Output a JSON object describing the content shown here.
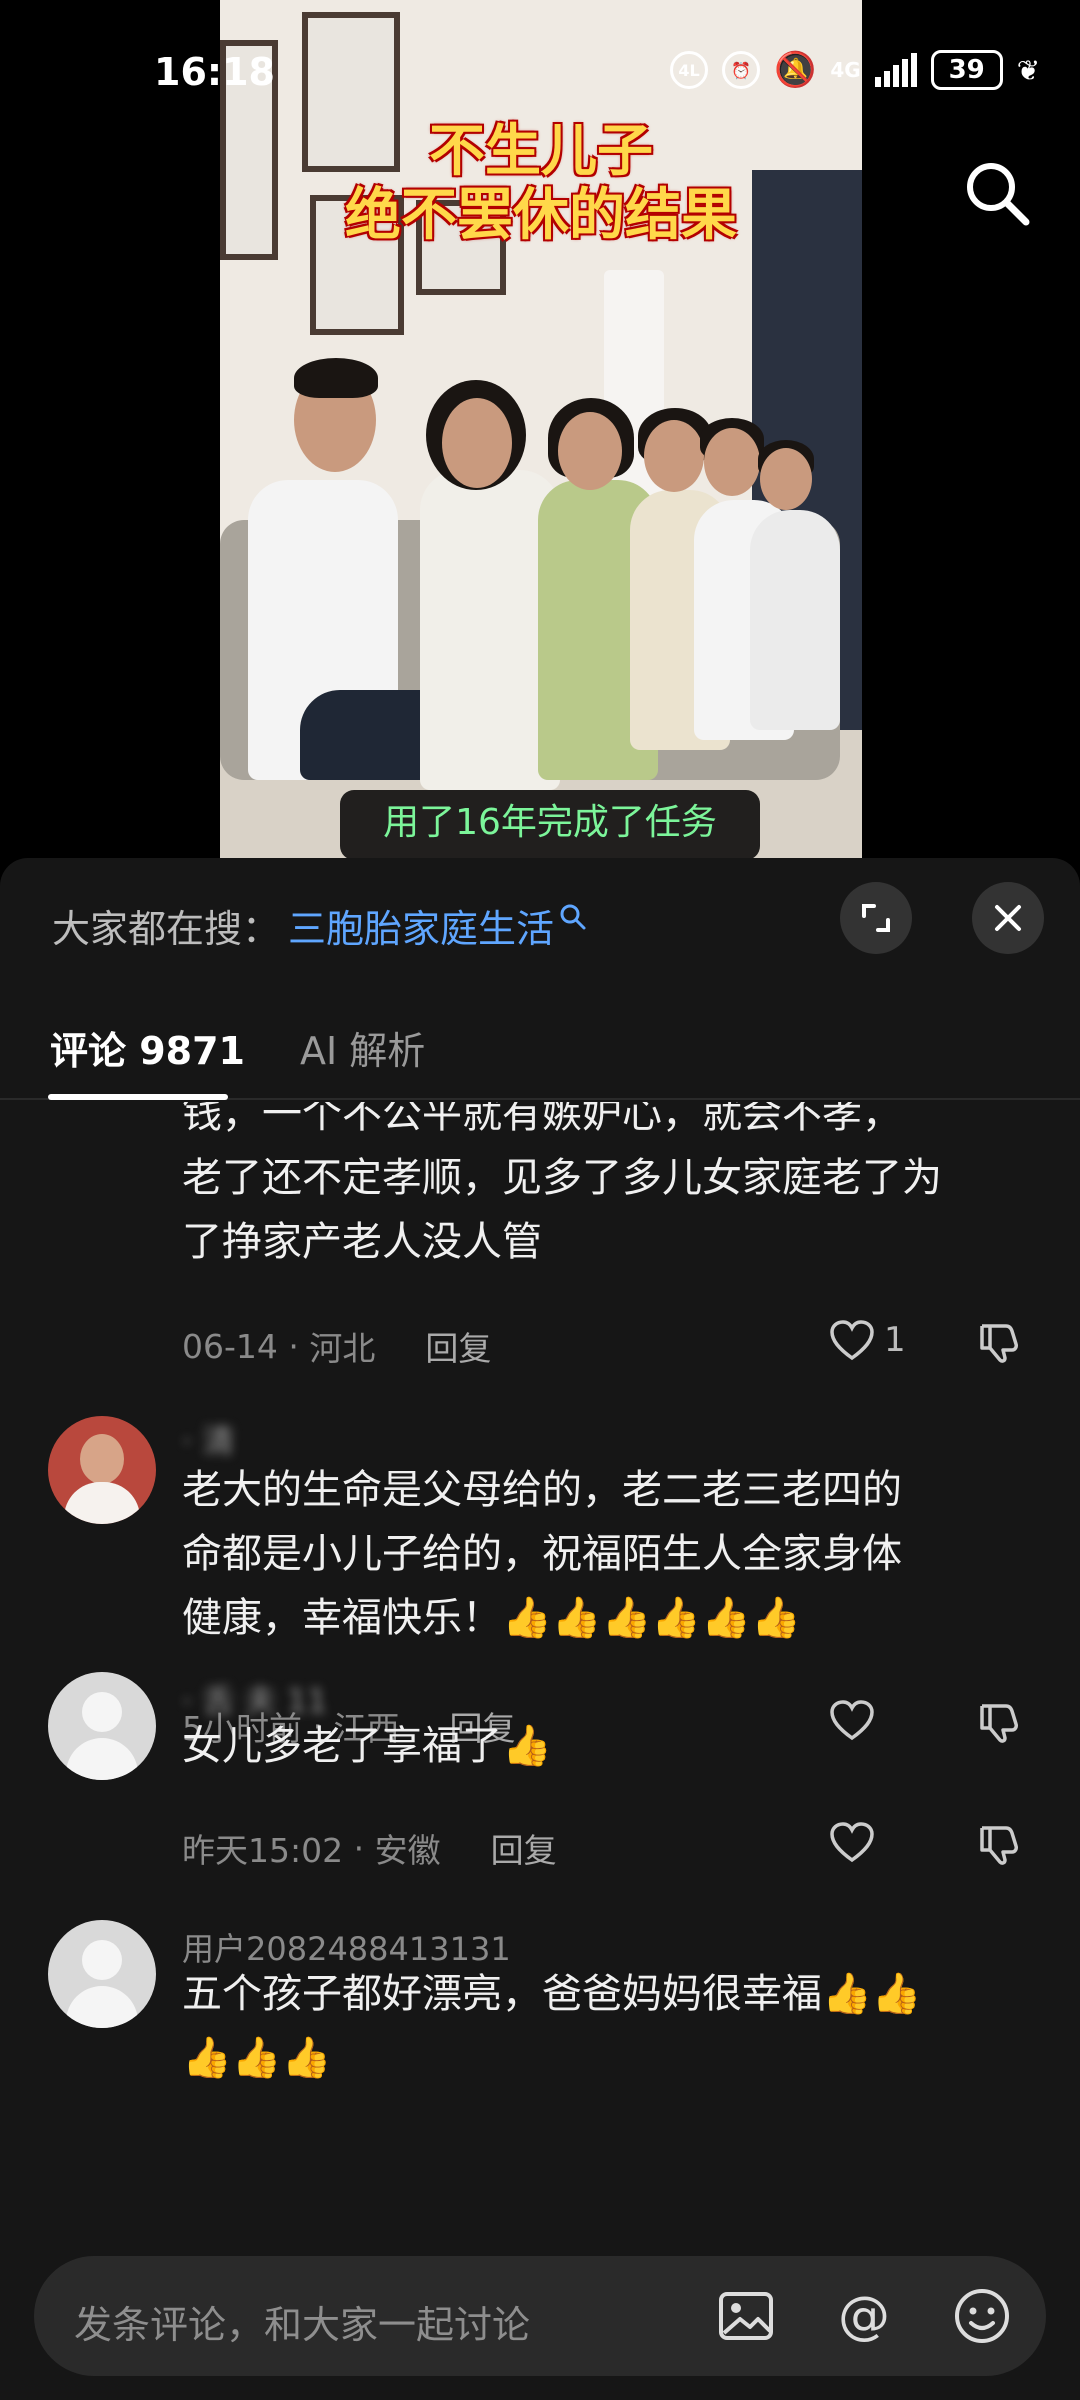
{
  "status_bar": {
    "time": "16:18",
    "network": "4G",
    "battery": "39"
  },
  "video": {
    "title_line1": "不生儿子",
    "title_line2": "绝不罢休的结果",
    "subtitle": "用了16年完成了任务"
  },
  "sheet": {
    "hot_search_label": "大家都在搜：",
    "hot_search_term": "三胞胎家庭生活",
    "tabs": [
      {
        "label": "评论 9871",
        "active": true
      },
      {
        "label": "AI 解析",
        "active": false
      }
    ]
  },
  "comments": [
    {
      "text": "钱，一个不公平就有嫉妒心，就会不孝，老了还不定孝顺，见多了多儿女家庭老了为了挣家产老人没人管",
      "line1": "钱，一个不公平就有嫉妒心，就会不孝，",
      "line2": "老了还不定孝顺，见多了多儿女家庭老了为",
      "line3": "了挣家产老人没人管",
      "date": "06-14",
      "location": "河北",
      "reply": "回复",
      "likes": "1"
    },
    {
      "username": "· 清",
      "line1": "老大的生命是父母给的，老二老三老四的",
      "line2": "命都是小儿子给的，祝福陌生人全家身体",
      "line3": "健康，幸福快乐！👍👍👍👍👍👍",
      "date": "5小时前",
      "location": "江西",
      "reply": "回复"
    },
    {
      "username": "· 舌 夫 11",
      "line1": "女儿多老了享福了👍",
      "date": "昨天15:02",
      "location": "安徽",
      "reply": "回复"
    },
    {
      "username": "用户2082488413131",
      "line1": "五个孩子都好漂亮，爸爸妈妈很幸福👍👍",
      "line2": "👍👍👍"
    }
  ],
  "input": {
    "placeholder": "发条评论，和大家一起讨论"
  },
  "colors": {
    "sheet_bg": "#161616",
    "link": "#5fa6ff",
    "subtitle": "#7cf59a",
    "title_yellow": "#ffd84a"
  }
}
